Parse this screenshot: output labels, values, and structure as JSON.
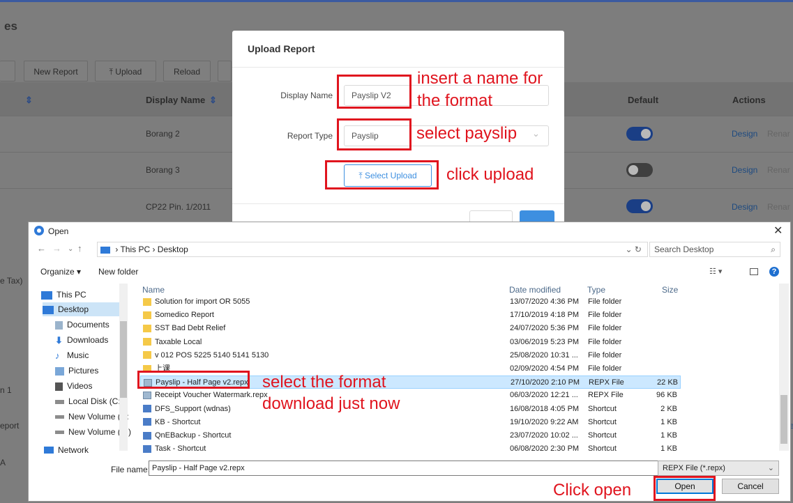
{
  "background": {
    "page_title_fragment": "es",
    "toolbar": [
      "New Report",
      "⤒ Upload",
      "Reload"
    ],
    "table_headers": {
      "col1_sort": "⇕",
      "display_name": "Display Name",
      "display_sort": "⇕",
      "default": "Default",
      "actions": "Actions"
    },
    "rows": [
      {
        "display_name": "Borang 2",
        "default_on": true,
        "design": "Design",
        "rename": "Renar"
      },
      {
        "display_name": "Borang 3",
        "default_on": false,
        "design": "Design",
        "rename": "Renar"
      },
      {
        "display_name": "CP22 Pin. 1/2011",
        "default_on": true,
        "design": "Design",
        "rename": "Renar"
      }
    ],
    "left_edge_fragments": [
      "e Tax)",
      "n 1",
      "eport",
      "A"
    ],
    "right_edge_fragment": "re"
  },
  "modal": {
    "title": "Upload Report",
    "display_name_label": "Display Name",
    "display_name_value": "Payslip V2",
    "report_type_label": "Report Type",
    "report_type_value": "Payslip",
    "select_upload_label": "Select Upload",
    "upload_icon": "⤒",
    "dropdown_icon": "⌄"
  },
  "annotations": {
    "name_hint_line1": "insert a name for",
    "name_hint_line2": "the format",
    "select_payslip": "select payslip",
    "click_upload": "click upload",
    "select_format_line1": "select the format",
    "select_format_line2": "download just now",
    "click_open": "Click open",
    "color": "#e0141e"
  },
  "dialog": {
    "title": "Open",
    "close": "✕",
    "breadcrumb": "› This PC › Desktop",
    "search_placeholder": "Search Desktop",
    "organize": "Organize ▾",
    "new_folder": "New folder",
    "nav_items": [
      "This PC",
      "Desktop",
      "Documents",
      "Downloads",
      "Music",
      "Pictures",
      "Videos",
      "Local Disk (C:)",
      "New Volume (D:",
      "New Volume (E:)",
      "Network"
    ],
    "columns": {
      "name": "Name",
      "date": "Date modified",
      "type": "Type",
      "size": "Size"
    },
    "files": [
      {
        "name": "Solution for import OR 5055",
        "date": "13/07/2020 4:36 PM",
        "type": "File folder",
        "size": "",
        "icon": "folder"
      },
      {
        "name": "Somedico Report",
        "date": "17/10/2019 4:18 PM",
        "type": "File folder",
        "size": "",
        "icon": "folder"
      },
      {
        "name": "SST Bad Debt Relief",
        "date": "24/07/2020 5:36 PM",
        "type": "File folder",
        "size": "",
        "icon": "folder"
      },
      {
        "name": "Taxable Local",
        "date": "03/06/2019 5:23 PM",
        "type": "File folder",
        "size": "",
        "icon": "folder"
      },
      {
        "name": "v 012 POS 5225 5140 5141 5130",
        "date": "25/08/2020 10:31 ...",
        "type": "File folder",
        "size": "",
        "icon": "folder"
      },
      {
        "name": "上课",
        "date": "02/09/2020 4:54 PM",
        "type": "File folder",
        "size": "",
        "icon": "folder"
      },
      {
        "name": "Payslip - Half Page v2.repx",
        "date": "27/10/2020 2:10 PM",
        "type": "REPX File",
        "size": "22 KB",
        "icon": "repx",
        "selected": true
      },
      {
        "name": "Receipt Voucher Watermark.repx",
        "date": "06/03/2020 12:21 ...",
        "type": "REPX File",
        "size": "96 KB",
        "icon": "repx"
      },
      {
        "name": "DFS_Support (wdnas)",
        "date": "16/08/2018 4:05 PM",
        "type": "Shortcut",
        "size": "2 KB",
        "icon": "shortcut"
      },
      {
        "name": "KB - Shortcut",
        "date": "19/10/2020 9:22 AM",
        "type": "Shortcut",
        "size": "1 KB",
        "icon": "shortcut"
      },
      {
        "name": "QnEBackup - Shortcut",
        "date": "23/07/2020 10:02 ...",
        "type": "Shortcut",
        "size": "1 KB",
        "icon": "shortcut"
      },
      {
        "name": "Task - Shortcut",
        "date": "06/08/2020 2:30 PM",
        "type": "Shortcut",
        "size": "1 KB",
        "icon": "shortcut"
      }
    ],
    "file_name_label": "File name:",
    "file_name_value": "Payslip - Half Page v2.repx",
    "file_type": "REPX File (*.repx)",
    "open_label": "Open",
    "cancel_label": "Cancel"
  }
}
